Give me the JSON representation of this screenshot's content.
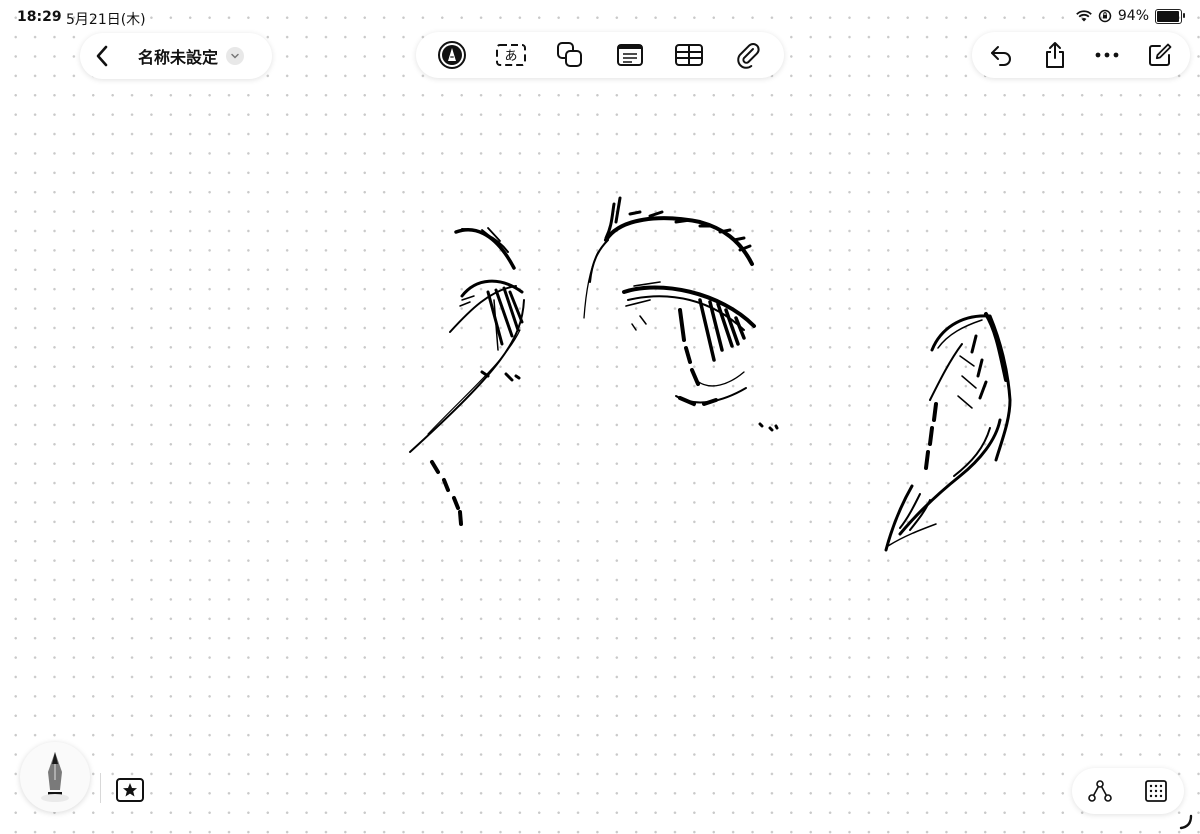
{
  "status_bar": {
    "time": "18:29",
    "date": "5月21日(木)",
    "battery_text": "94%",
    "battery_level": 0.94
  },
  "header": {
    "title": "名称未設定"
  },
  "toolbar": {
    "tools": [
      {
        "icon": "pen-markup-icon"
      },
      {
        "icon": "text-box-icon",
        "glyph": "あ"
      },
      {
        "icon": "shapes-icon"
      },
      {
        "icon": "sticky-note-icon"
      },
      {
        "icon": "table-icon"
      },
      {
        "icon": "attachment-icon"
      }
    ]
  },
  "actions": [
    {
      "icon": "undo-icon"
    },
    {
      "icon": "share-icon"
    },
    {
      "icon": "more-icon"
    },
    {
      "icon": "compose-icon"
    }
  ],
  "bottom_bar": {
    "pen_tool": "pen-tool-icon",
    "favorite": "star-icon",
    "connector": "connector-icon",
    "grid": "grid-icon"
  },
  "colors": {
    "ink": "#000000",
    "background": "#ffffff",
    "grid_dots": "#c9c9c9"
  }
}
